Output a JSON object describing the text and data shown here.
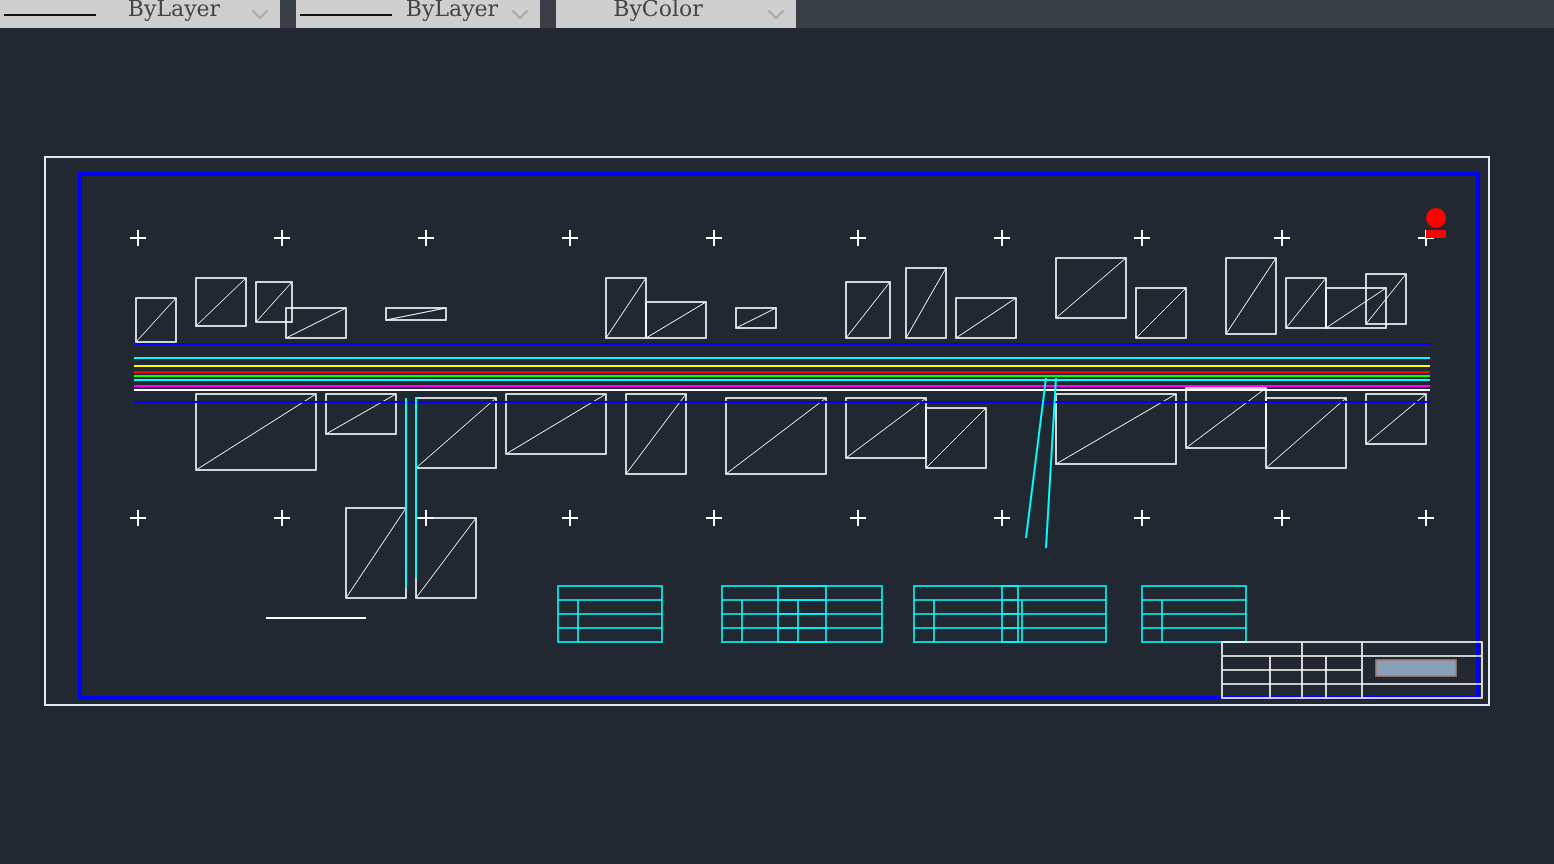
{
  "toolbar": {
    "dropdowns": [
      {
        "kind": "line",
        "value": "ByLayer"
      },
      {
        "kind": "line",
        "value": "ByLayer"
      },
      {
        "kind": "plain",
        "value": "ByColor"
      }
    ]
  }
}
